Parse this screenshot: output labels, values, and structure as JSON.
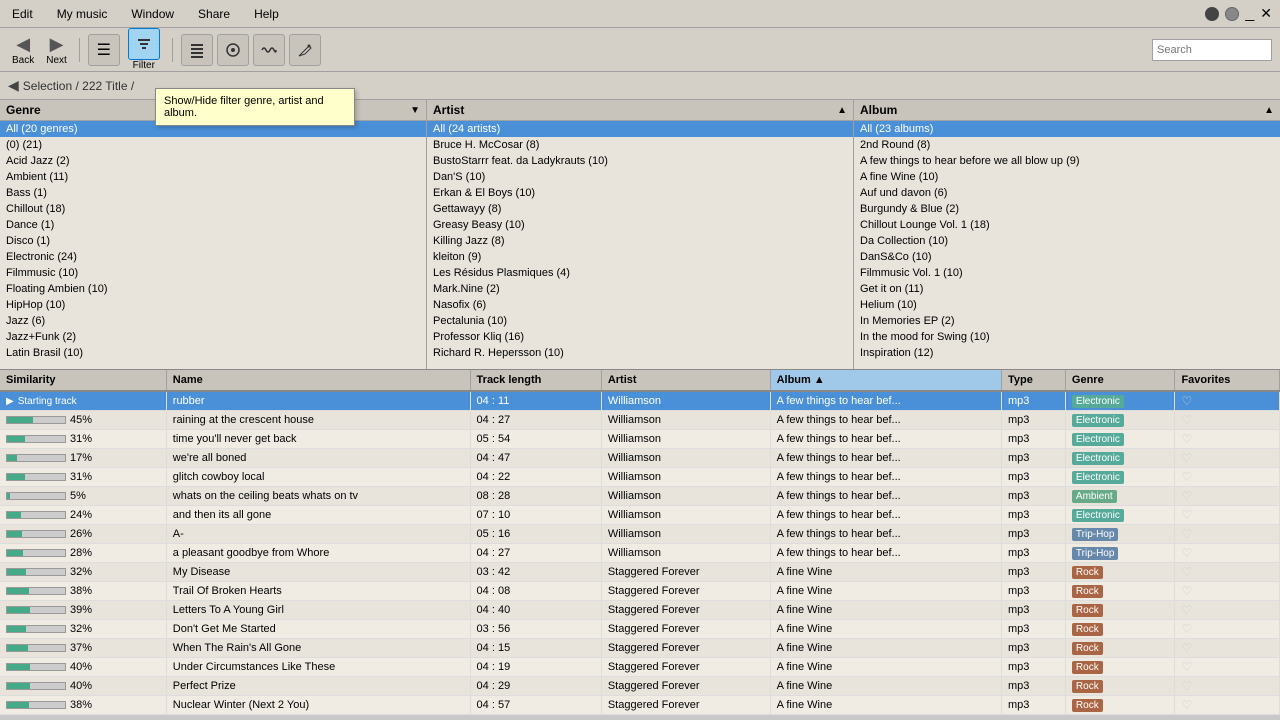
{
  "app": {
    "logo": "?"
  },
  "menu": {
    "items": [
      "Edit",
      "My music",
      "Window",
      "Share",
      "Help"
    ]
  },
  "toolbar": {
    "back_label": "Back",
    "next_label": "Next",
    "filter_label": "Filter",
    "search_label": "Search",
    "tooltip": "Show/Hide filter genre, artist and album."
  },
  "breadcrumb": {
    "text": "Selection / 222 Title /"
  },
  "panels": {
    "genre": {
      "header": "Genre",
      "items": [
        "All (20 genres)",
        "(0)  (21)",
        "Acid Jazz  (2)",
        "Ambient  (11)",
        "Bass  (1)",
        "Chillout  (18)",
        "Dance  (1)",
        "Disco  (1)",
        "Electronic  (24)",
        "Filmmusic  (10)",
        "Floating Ambien  (10)",
        "HipHop  (10)",
        "Jazz  (6)",
        "Jazz+Funk  (2)",
        "Latin Brasil  (10)"
      ]
    },
    "artist": {
      "header": "Artist",
      "items": [
        "All (24 artists)",
        "Bruce H. McCosar  (8)",
        "BustoStarrr feat. da Ladykrauts  (10)",
        "Dan'S  (10)",
        "Erkan & El Boys  (10)",
        "Gettawayy  (8)",
        "Greasy Beasy  (10)",
        "Killing Jazz  (8)",
        "kleiton  (9)",
        "Les Résidus Plasmiques  (4)",
        "Mark.Nine  (2)",
        "Nasofix  (6)",
        "Pectalunia  (10)",
        "Professor Kliq  (16)",
        "Richard R. Hepersson  (10)"
      ]
    },
    "album": {
      "header": "Album",
      "items": [
        "All (23 albums)",
        "2nd Round  (8)",
        "A few things to hear before we all blow up  (9)",
        "A fine Wine  (10)",
        "Auf und davon  (6)",
        "Burgundy & Blue  (2)",
        "Chillout Lounge Vol. 1  (18)",
        "Da Collection  (10)",
        "DanS&Co  (10)",
        "Filmmusic Vol. 1  (10)",
        "Get it on  (11)",
        "Helium  (10)",
        "In Memories EP  (2)",
        "In the mood for Swing  (10)",
        "Inspiration  (12)"
      ]
    }
  },
  "table": {
    "columns": [
      "Similarity",
      "Name",
      "Track length",
      "Artist",
      "Album",
      "Type",
      "Genre",
      "Favorites"
    ],
    "rows": [
      {
        "similarity": -1,
        "name": "rubber",
        "length": "04 : 11",
        "artist": "Williamson",
        "album": "A few things to hear bef...",
        "type": "mp3",
        "genre": "Electronic",
        "favorite": false,
        "starting": true
      },
      {
        "similarity": 45,
        "name": "raining at the crescent house",
        "length": "04 : 27",
        "artist": "Williamson",
        "album": "A few things to hear bef...",
        "type": "mp3",
        "genre": "Electronic",
        "favorite": false,
        "starting": false
      },
      {
        "similarity": 31,
        "name": "time you'll never get back",
        "length": "05 : 54",
        "artist": "Williamson",
        "album": "A few things to hear bef...",
        "type": "mp3",
        "genre": "Electronic",
        "favorite": false,
        "starting": false
      },
      {
        "similarity": 17,
        "name": "we're all boned",
        "length": "04 : 47",
        "artist": "Williamson",
        "album": "A few things to hear bef...",
        "type": "mp3",
        "genre": "Electronic",
        "favorite": false,
        "starting": false
      },
      {
        "similarity": 31,
        "name": "glitch cowboy local",
        "length": "04 : 22",
        "artist": "Williamson",
        "album": "A few things to hear bef...",
        "type": "mp3",
        "genre": "Electronic",
        "favorite": false,
        "starting": false
      },
      {
        "similarity": 5,
        "name": "whats on the ceiling beats whats on tv",
        "length": "08 : 28",
        "artist": "Williamson",
        "album": "A few things to hear bef...",
        "type": "mp3",
        "genre": "Ambient",
        "favorite": false,
        "starting": false
      },
      {
        "similarity": 24,
        "name": "and then its all gone",
        "length": "07 : 10",
        "artist": "Williamson",
        "album": "A few things to hear bef...",
        "type": "mp3",
        "genre": "Electronic",
        "favorite": false,
        "starting": false
      },
      {
        "similarity": 26,
        "name": "A-",
        "length": "05 : 16",
        "artist": "Williamson",
        "album": "A few things to hear bef...",
        "type": "mp3",
        "genre": "Trip-Hop",
        "favorite": false,
        "starting": false
      },
      {
        "similarity": 28,
        "name": "a pleasant goodbye from Whore",
        "length": "04 : 27",
        "artist": "Williamson",
        "album": "A few things to hear bef...",
        "type": "mp3",
        "genre": "Trip-Hop",
        "favorite": false,
        "starting": false
      },
      {
        "similarity": 32,
        "name": "My Disease",
        "length": "03 : 42",
        "artist": "Staggered Forever",
        "album": "A fine Wine",
        "type": "mp3",
        "genre": "Rock",
        "favorite": false,
        "starting": false
      },
      {
        "similarity": 38,
        "name": "Trail Of Broken Hearts",
        "length": "04 : 08",
        "artist": "Staggered Forever",
        "album": "A fine Wine",
        "type": "mp3",
        "genre": "Rock",
        "favorite": false,
        "starting": false
      },
      {
        "similarity": 39,
        "name": "Letters To A Young Girl",
        "length": "04 : 40",
        "artist": "Staggered Forever",
        "album": "A fine Wine",
        "type": "mp3",
        "genre": "Rock",
        "favorite": false,
        "starting": false
      },
      {
        "similarity": 32,
        "name": "Don't Get Me Started",
        "length": "03 : 56",
        "artist": "Staggered Forever",
        "album": "A fine Wine",
        "type": "mp3",
        "genre": "Rock",
        "favorite": false,
        "starting": false
      },
      {
        "similarity": 37,
        "name": "When The Rain's All Gone",
        "length": "04 : 15",
        "artist": "Staggered Forever",
        "album": "A fine Wine",
        "type": "mp3",
        "genre": "Rock",
        "favorite": false,
        "starting": false
      },
      {
        "similarity": 40,
        "name": "Under Circumstances Like These",
        "length": "04 : 19",
        "artist": "Staggered Forever",
        "album": "A fine Wine",
        "type": "mp3",
        "genre": "Rock",
        "favorite": false,
        "starting": false
      },
      {
        "similarity": 40,
        "name": "Perfect Prize",
        "length": "04 : 29",
        "artist": "Staggered Forever",
        "album": "A fine Wine",
        "type": "mp3",
        "genre": "Rock",
        "favorite": false,
        "starting": false
      },
      {
        "similarity": 38,
        "name": "Nuclear Winter (Next 2 You)",
        "length": "04 : 57",
        "artist": "Staggered Forever",
        "album": "A fine Wine",
        "type": "mp3",
        "genre": "Rock",
        "favorite": false,
        "starting": false
      }
    ]
  },
  "system_bar": {
    "window_controls": [
      "minimize",
      "maximize",
      "close"
    ]
  }
}
